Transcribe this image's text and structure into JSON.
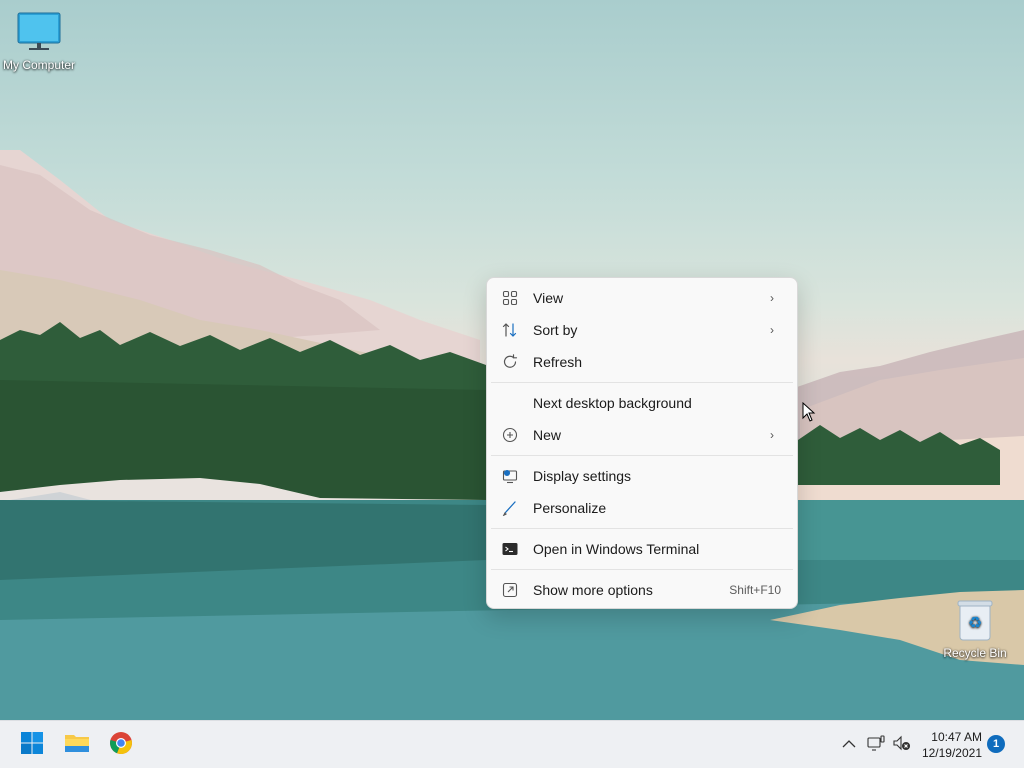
{
  "desktop": {
    "icons": [
      {
        "label": "My Computer",
        "icon": "monitor-icon"
      },
      {
        "label": "Recycle Bin",
        "icon": "recycle-bin-icon"
      }
    ]
  },
  "context_menu": {
    "items": [
      {
        "label": "View",
        "icon": "view-grid-icon",
        "submenu": true
      },
      {
        "label": "Sort by",
        "icon": "sort-icon",
        "submenu": true
      },
      {
        "label": "Refresh",
        "icon": "refresh-icon"
      },
      {
        "label": "Next desktop background"
      },
      {
        "label": "New",
        "icon": "new-plus-icon",
        "submenu": true
      },
      {
        "label": "Display settings",
        "icon": "display-settings-icon"
      },
      {
        "label": "Personalize",
        "icon": "pen-icon"
      },
      {
        "label": "Open in Windows Terminal",
        "icon": "terminal-icon"
      },
      {
        "label": "Show more options",
        "icon": "more-options-icon",
        "shortcut": "Shift+F10"
      }
    ],
    "submenu_glyph": "›"
  },
  "taskbar": {
    "apps": [
      {
        "name": "Start",
        "icon": "windows-start-icon"
      },
      {
        "name": "File Explorer",
        "icon": "folder-icon"
      },
      {
        "name": "Chrome",
        "icon": "chrome-icon"
      }
    ],
    "tray": {
      "chevron_glyph": "^",
      "time": "10:47 AM",
      "date": "12/19/2021",
      "notifications": "1"
    }
  }
}
